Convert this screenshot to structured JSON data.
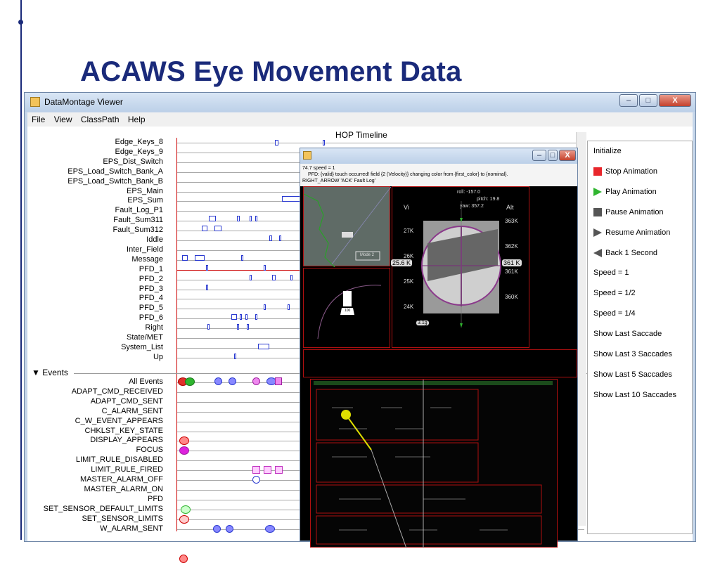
{
  "slide": {
    "title": "ACAWS Eye Movement Data"
  },
  "window": {
    "title": "DataMontage Viewer",
    "menu": [
      "File",
      "View",
      "ClassPath",
      "Help"
    ],
    "buttons": {
      "minimize": "–",
      "maximize": "□",
      "close": "X"
    }
  },
  "timeline": {
    "title": "HOP Timeline",
    "rows": [
      "Edge_Keys_8",
      "Edge_Keys_9",
      "EPS_Dist_Switch",
      "EPS_Load_Switch_Bank_A",
      "EPS_Load_Switch_Bank_B",
      "EPS_Main",
      "EPS_Sum",
      "Fault_Log_P1",
      "Fault_Sum311",
      "Fault_Sum312",
      "Iddle",
      "Inter_Field",
      "Message",
      "PFD_1",
      "PFD_2",
      "PFD_3",
      "PFD_4",
      "PFD_5",
      "PFD_6",
      "Right",
      "State/MET",
      "System_List",
      "Up"
    ],
    "events_header": "▼ Events",
    "events": [
      "All Events",
      "ADAPT_CMD_RECEIVED",
      "ADAPT_CMD_SENT",
      "C_ALARM_SENT",
      "C_W_EVENT_APPEARS",
      "CHKLST_KEY_STATE",
      "DISPLAY_APPEARS",
      "FOCUS",
      "LIMIT_RULE_DISABLED",
      "LIMIT_RULE_FIRED",
      "MASTER_ALARM_OFF",
      "MASTER_ALARM_ON",
      "PFD",
      "SET_SENSOR_DEFAULT_LIMITS",
      "SET_SENSOR_LIMITS",
      "W_ALARM_SENT"
    ]
  },
  "controls": {
    "items": [
      "Initialize",
      "Stop Animation",
      "Play Animation",
      "Pause Animation",
      "Resume Animation",
      "Back 1 Second",
      "Speed = 1",
      "Speed = 1/2",
      "Speed = 1/4",
      "Show Last Saccade",
      "Show Last 3 Saccades",
      "Show Last 5 Saccades",
      "Show Last 10 Saccades"
    ],
    "icons": [
      "none",
      "stop-icon",
      "play-icon",
      "pause-icon",
      "resume-icon",
      "back-icon",
      "none",
      "none",
      "none",
      "none",
      "none",
      "none",
      "none"
    ],
    "colors": {
      "stop": "#e8262b",
      "play": "#2fb52f",
      "pause": "#555555",
      "resume": "#555555",
      "back": "#555555"
    }
  },
  "overlay": {
    "info_line1": "74.7   speed = 1",
    "info_line2": "PFD: {valid} touch occurred! field {2 (Velocity}} changing color from {first_color} to {nominal}.",
    "info_line3": "RIGHT_ARROW 'ACK' Fault Log'",
    "pfd": {
      "roll": "roll: -157.0",
      "pitch": "pitch: 19.8",
      "yaw": "yaw: 357.2",
      "vi_label": "Vi",
      "alt_label": "Alt",
      "vi_ticks": [
        "27K",
        "26K",
        "25K",
        "24K"
      ],
      "vi_value": "25.6 K",
      "alt_ticks": [
        "363K",
        "362K",
        "361K",
        "360K"
      ],
      "alt_value": "361 K",
      "box_value": "3.1g",
      "mode_label": "Mode 2",
      "small_value": "100"
    }
  }
}
